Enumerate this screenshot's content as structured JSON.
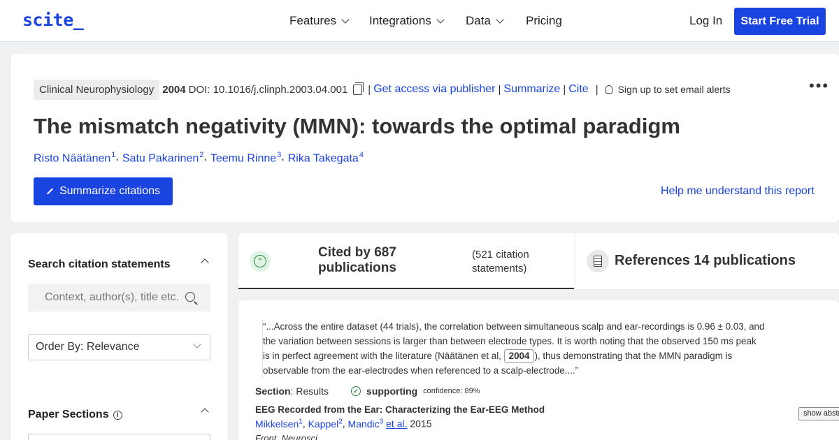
{
  "nav": {
    "logo": "scite_",
    "items": [
      "Features",
      "Integrations",
      "Data",
      "Pricing"
    ],
    "login": "Log In",
    "trial": "Start Free Trial"
  },
  "paper": {
    "journal": "Clinical Neurophysiology",
    "year": "2004",
    "doi": "DOI: 10.1016/j.clinph.2003.04.001",
    "access_link": "Get access via publisher",
    "summarize_link": "Summarize",
    "cite_link": "Cite",
    "alerts": "Sign up to set email alerts",
    "title": "The mismatch negativity (MMN): towards the optimal paradigm",
    "authors": [
      {
        "name": "Risto Näätänen",
        "sup": "1"
      },
      {
        "name": "Satu Pakarinen",
        "sup": "2"
      },
      {
        "name": "Teemu Rinne",
        "sup": "3"
      },
      {
        "name": "Rika Takegata",
        "sup": "4"
      }
    ],
    "summarize_button": "Summarize citations",
    "help_link": "Help me understand this report"
  },
  "sidebar": {
    "search_heading": "Search citation statements",
    "search_placeholder": "Context, author(s), title etc.",
    "order_by": "Order By: Relevance",
    "sections_heading": "Paper Sections"
  },
  "tabs": {
    "cited_line1": "Cited by 687",
    "cited_line2": "publications",
    "statements_line1": "(521 citation",
    "statements_line2": "statements)",
    "references": "References 14 publications"
  },
  "citation": {
    "quote_part1": "“...Across the entire dataset (44 trials), the correlation between simultaneous scalp and ear-recordings is 0.96 ± 0.03, and the variation between sessions is larger than between electrode types. It is worth noting that the observed 150 ms peak is in perfect agreement with the literature (Näätänen et al,",
    "quote_year": "2004",
    "quote_part2": "), thus demonstrating that the MMN paradigm is observable from the ear-electrodes when referenced to a scalp-electrode....”",
    "section_label": "Section",
    "section_value": ": Results",
    "type": "supporting",
    "confidence": "confidence: 89%",
    "paper_title": "EEG Recorded from the Ear: Characterizing the Ear-EEG Method",
    "authors": [
      {
        "name": "Mikkelsen",
        "sup": "1"
      },
      {
        "name": "Kappel",
        "sup": "2"
      },
      {
        "name": "Mandic",
        "sup": "3"
      }
    ],
    "etal": "et al.",
    "year": "2015",
    "journal": "Front. Neurosci.",
    "show_abstract": "show abstract"
  }
}
